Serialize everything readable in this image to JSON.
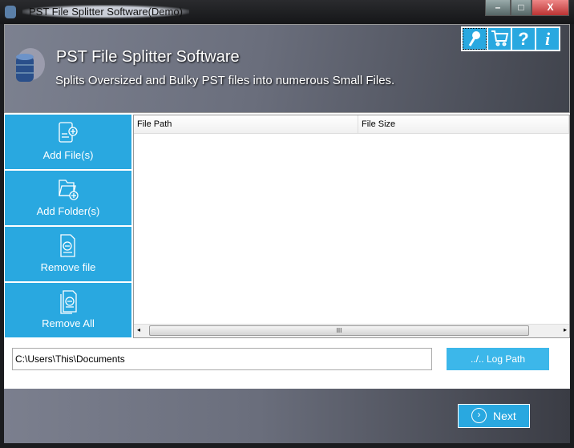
{
  "window": {
    "title": "PST File Splitter Software(Demo)",
    "min": "–",
    "max": "□",
    "close": "X"
  },
  "header": {
    "title": "PST File Splitter Software",
    "subtitle": "Splits Oversized and Bulky PST files into numerous Small Files.",
    "tools": [
      {
        "icon": "key-icon"
      },
      {
        "icon": "cart-icon"
      },
      {
        "icon": "help-icon",
        "label": "?"
      },
      {
        "icon": "info-icon",
        "label": "i"
      }
    ]
  },
  "sidebar": [
    {
      "label": "Add File(s)"
    },
    {
      "label": "Add Folder(s)"
    },
    {
      "label": "Remove file"
    },
    {
      "label": "Remove All"
    }
  ],
  "table": {
    "columns": [
      "File Path",
      "File Size"
    ],
    "rows": [],
    "scroll_grip": "III"
  },
  "log": {
    "path": "C:\\Users\\This\\Documents",
    "button": "../.. Log Path"
  },
  "footer": {
    "next": "Next"
  },
  "colors": {
    "accent": "#29a8e0"
  }
}
